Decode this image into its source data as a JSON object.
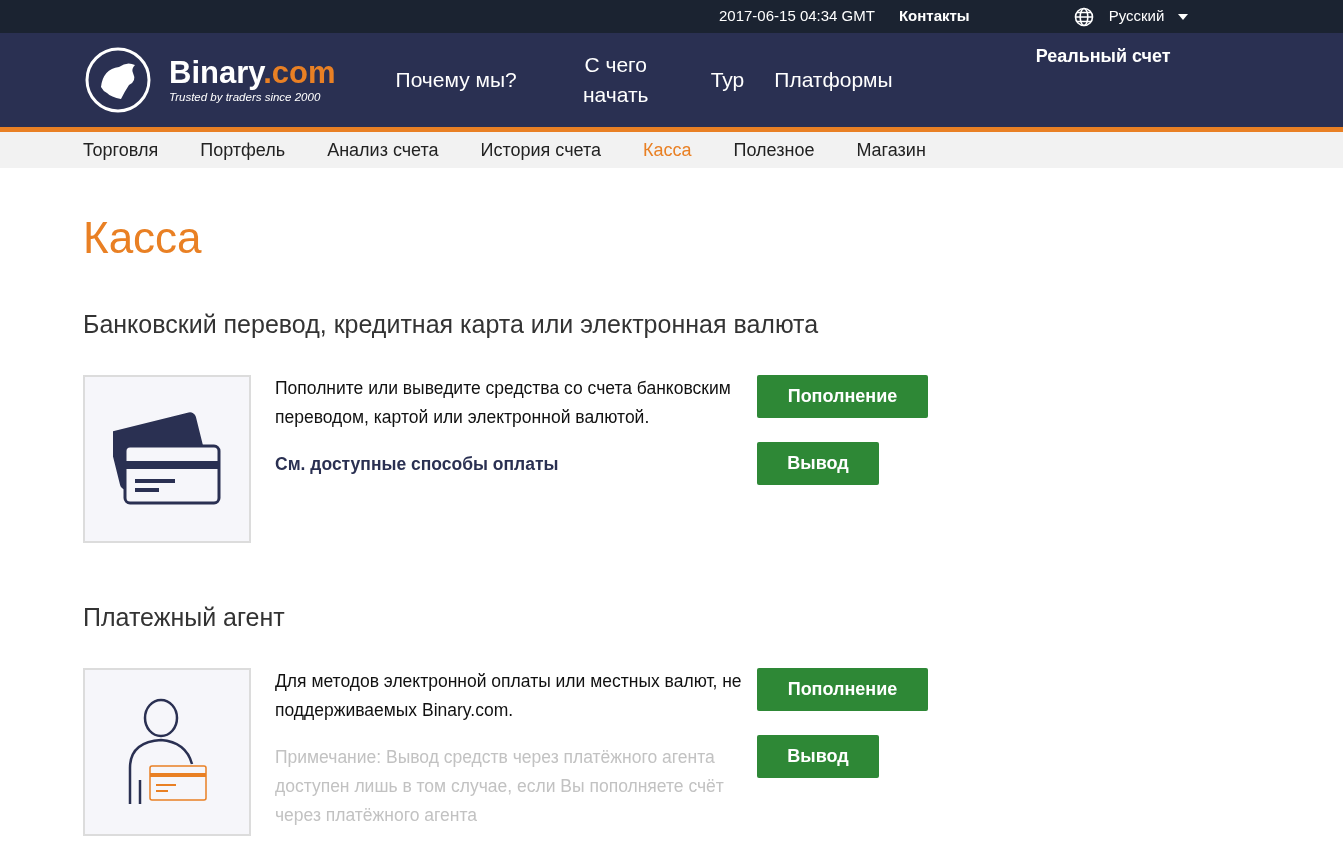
{
  "top_bar": {
    "datetime": "2017-06-15 04:34 GMT",
    "contacts": "Контакты",
    "language": "Русский"
  },
  "header": {
    "logo": {
      "name": "Binary",
      "suffix": ".com",
      "tagline": "Trusted by traders since 2000"
    },
    "nav": [
      "Почему мы?",
      "С чего начать",
      "Тур",
      "Платформы"
    ],
    "account": "Реальный счет"
  },
  "subnav": [
    {
      "label": "Торговля",
      "selected": false
    },
    {
      "label": "Портфель",
      "selected": false
    },
    {
      "label": "Анализ счета",
      "selected": false
    },
    {
      "label": "История счета",
      "selected": false
    },
    {
      "label": "Касса",
      "selected": true
    },
    {
      "label": "Полезное",
      "selected": false
    },
    {
      "label": "Магазин",
      "selected": false
    }
  ],
  "page_title": "Касса",
  "sections": [
    {
      "kind": "bank",
      "heading": "Банковский перевод, кредитная карта или электронная валюта",
      "description": "Пополните или выведите средства со счета банковским переводом, картой или электронной валютой.",
      "link": "См. доступные способы оплаты",
      "buttons": [
        "Пополнение",
        "Вывод"
      ]
    },
    {
      "kind": "agent",
      "heading": "Платежный агент",
      "description": "Для методов электронной оплаты или местных валют, не поддерживаемых Binary.com.",
      "note": "Примечание: Вывод средств через платёжного агента доступен лишь в том случае, если Вы пополняете счёт через платёжного агента",
      "buttons": [
        "Пополнение",
        "Вывод"
      ]
    }
  ]
}
